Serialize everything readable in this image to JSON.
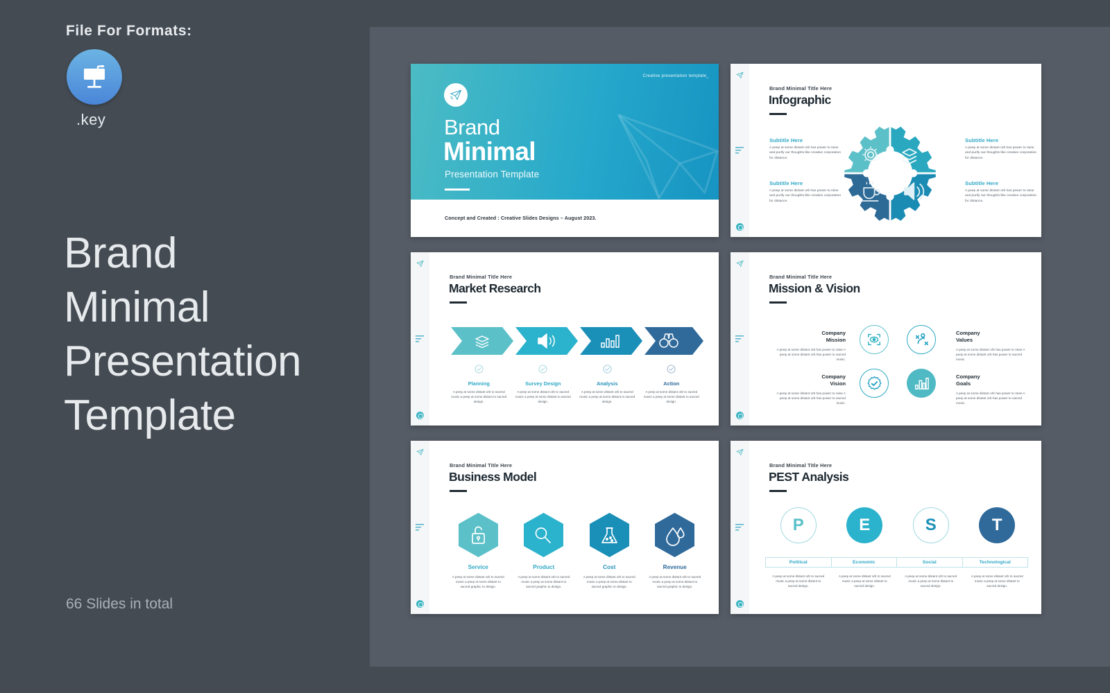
{
  "promo": {
    "format_label": "File For Formats:",
    "format_icon": "keynote-icon",
    "format_ext": ".key",
    "title": "Brand\nMinimal\nPresentation\nTemplate",
    "slide_count": "66 Slides in total"
  },
  "colors": {
    "page_bg": "#444b53",
    "panel_bg": "#565c66",
    "accent_light": "#5bc0c8",
    "accent_teal": "#2bb2cc",
    "accent_blue": "#1a8fb8",
    "accent_dark": "#2f6a9b",
    "heading": "#1d2830",
    "body_text": "#5a636c"
  },
  "slides": [
    {
      "id": "title-slide",
      "kind": "title",
      "tag": "Creative presentation template_",
      "logo_icon": "paper-plane-icon",
      "brand": "Brand",
      "brand_bold": "Minimal",
      "subtitle": "Presentation Template",
      "credit": "Concept and Created : Creative Slides Designs – August 2023."
    },
    {
      "id": "infographic-slide",
      "kind": "infographic",
      "eyebrow": "Brand Minimal Title Here",
      "headline": "Infographic",
      "graphic": "gear-puzzle-diagram",
      "quadrants": [
        {
          "position": "top-left",
          "icon": "gear-icon",
          "color": "#5cc0c8"
        },
        {
          "position": "top-right",
          "icon": "layers-icon",
          "color": "#29a8c0"
        },
        {
          "position": "bottom-left",
          "icon": "coffee-cup-icon",
          "color": "#2e6a96"
        },
        {
          "position": "bottom-right",
          "icon": "speaker-icon",
          "color": "#1a8bb3"
        }
      ],
      "items": [
        {
          "subtitle": "Subtitle Here",
          "body": "A peep at some distant orb has power to raise and purify our thoughts like creative corporation for distance."
        },
        {
          "subtitle": "Subtitle Here",
          "body": "A peep at some distant orb has power to raise and purify our thoughts like creative corporation for distance."
        },
        {
          "subtitle": "Subtitle Here",
          "body": "A peep at some distant orb has power to raise and purify our thoughts like creative corporation for distance."
        },
        {
          "subtitle": "Subtitle Here",
          "body": "A peep at some distant orb has power to raise and purify our thoughts like creative corporation for distance."
        }
      ]
    },
    {
      "id": "market-research-slide",
      "kind": "process",
      "eyebrow": "Brand Minimal Title Here",
      "headline": "Market Research",
      "steps": [
        {
          "name": "Planning",
          "icon": "layers-icon",
          "color": "#5bc0c8"
        },
        {
          "name": "Survey Design",
          "icon": "speaker-icon",
          "color": "#2bb2cc"
        },
        {
          "name": "Analysis",
          "icon": "bar-chart-icon",
          "color": "#1a8fb8"
        },
        {
          "name": "Action",
          "icon": "binoculars-icon",
          "color": "#2f6a9b"
        }
      ],
      "step_body": "A peep at some distant orb to sacred music a peep at some distant to sacred design."
    },
    {
      "id": "mission-vision-slide",
      "kind": "quad",
      "eyebrow": "Brand Minimal Title Here",
      "headline": "Mission & Vision",
      "cells": [
        {
          "title": "Company\nMission",
          "icon": "eye-target-icon",
          "style": "outline",
          "side": "left"
        },
        {
          "title": "Company\nValues",
          "icon": "strategy-icon",
          "style": "outline2",
          "side": "right"
        },
        {
          "title": "Company\nVision",
          "icon": "badge-check-icon",
          "style": "outline2",
          "side": "left"
        },
        {
          "title": "Company\nGoals",
          "icon": "bar-chart-icon",
          "style": "filled",
          "side": "right"
        }
      ],
      "cell_body": "A peep at some distant orb has power to raise A peep at some distant orb has power to sacred music."
    },
    {
      "id": "business-model-slide",
      "kind": "hexagons",
      "eyebrow": "Brand Minimal Title Here",
      "headline": "Business Model",
      "items": [
        {
          "name": "Service",
          "icon": "unlock-icon",
          "color": "#5bc0c8"
        },
        {
          "name": "Product",
          "icon": "search-icon",
          "color": "#2bb2cc"
        },
        {
          "name": "Cost",
          "icon": "flask-icon",
          "color": "#1a8fb8"
        },
        {
          "name": "Revenue",
          "icon": "water-drop-icon",
          "color": "#2f6a9b"
        }
      ],
      "item_body": "A peep at some distant orb to sacred music a peep at some distant to sacred graphic to design."
    },
    {
      "id": "pest-analysis-slide",
      "kind": "pest",
      "eyebrow": "Brand Minimal Title Here",
      "headline": "PEST Analysis",
      "items": [
        {
          "letter": "P",
          "label": "Political",
          "style": "outline",
          "color": "#5bc0c8"
        },
        {
          "letter": "E",
          "label": "Economic",
          "style": "filled",
          "color": "#2bb2cc"
        },
        {
          "letter": "S",
          "label": "Social",
          "style": "outline",
          "color": "#1a8fb8"
        },
        {
          "letter": "T",
          "label": "Technological",
          "style": "filled",
          "color": "#2f6a9b"
        }
      ],
      "item_body": "A peep at some distant orb to sacred music a peep at some distant to sacred design."
    }
  ]
}
